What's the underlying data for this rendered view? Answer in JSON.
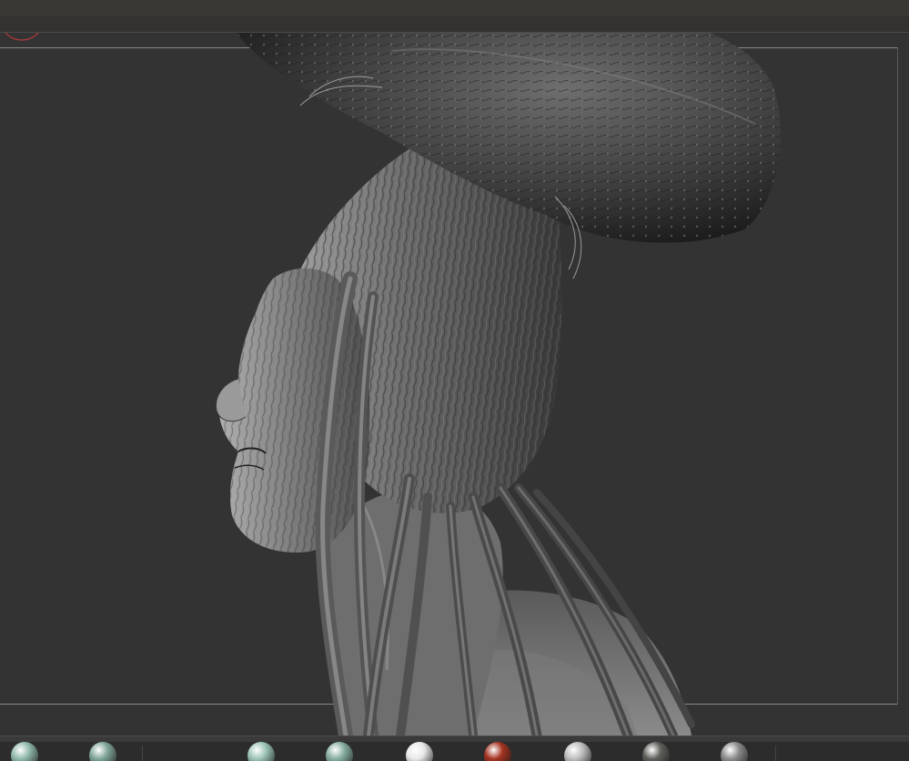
{
  "app": {
    "viewport_subject": "mushroom-cap-head-sculpt"
  },
  "materials": [
    {
      "name": "mint-matcap",
      "color": "#8fb8aa"
    },
    {
      "name": "mint-flat-matcap",
      "color": "#7ea598"
    },
    {
      "name": "mint-glossy-matcap",
      "color": "#9bc4b6"
    },
    {
      "name": "mint-shaded-matcap",
      "color": "#86aea0"
    },
    {
      "name": "white-matcap",
      "color": "#e8e8e8"
    },
    {
      "name": "red-matcap",
      "color": "#a3321f"
    },
    {
      "name": "silver-matcap",
      "color": "#bdbdbd"
    },
    {
      "name": "dark-gray-matcap",
      "color": "#5e5e5a"
    },
    {
      "name": "gray-matcap",
      "color": "#8a8a8a"
    }
  ],
  "colors": {
    "background": "#333333",
    "sculpt_base": "#6a6a6a",
    "sculpt_highlight": "#a8a8a8",
    "sculpt_shadow": "#1c1c1c",
    "gizmo_red": "#b23a3a"
  }
}
